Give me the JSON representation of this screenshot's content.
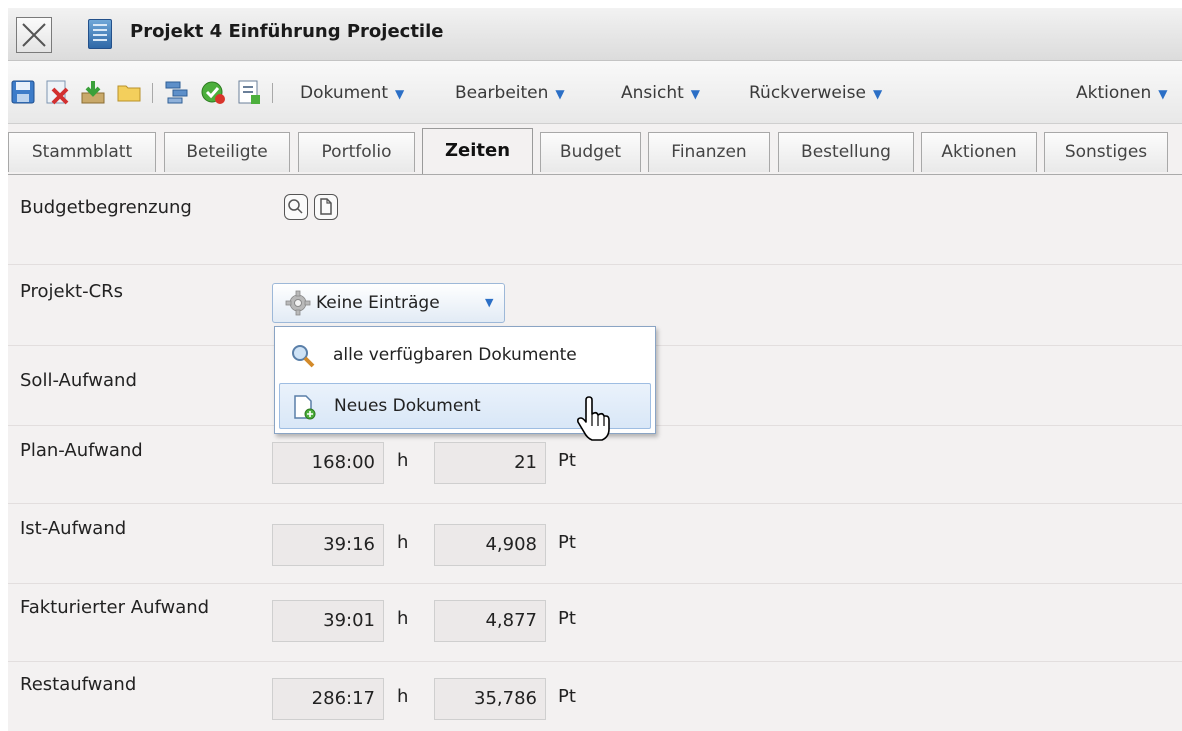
{
  "window": {
    "title": "Projekt 4 Einführung Projectile"
  },
  "toolbar": {
    "icons": [
      "save-icon",
      "delete-icon",
      "import-icon",
      "folder-icon",
      "copy-icon",
      "approve-icon",
      "report-icon"
    ],
    "menus": [
      {
        "label": "Dokument"
      },
      {
        "label": "Bearbeiten"
      },
      {
        "label": "Ansicht"
      },
      {
        "label": "Rückverweise"
      },
      {
        "label": "Aktionen"
      }
    ]
  },
  "tabs": [
    {
      "label": "Stammblatt"
    },
    {
      "label": "Beteiligte"
    },
    {
      "label": "Portfolio"
    },
    {
      "label": "Zeiten",
      "active": true
    },
    {
      "label": "Budget"
    },
    {
      "label": "Finanzen"
    },
    {
      "label": "Bestellung"
    },
    {
      "label": "Aktionen"
    },
    {
      "label": "Sonstiges"
    }
  ],
  "form": {
    "budgetbegrenzung": {
      "label": "Budgetbegrenzung"
    },
    "projekt_crs": {
      "label": "Projekt-CRs",
      "button_label": "Keine Einträge"
    },
    "soll_aufwand": {
      "label": "Soll-Aufwand"
    },
    "plan_aufwand": {
      "label": "Plan-Aufwand",
      "hours": "168:00",
      "hours_unit": "h",
      "points": "21",
      "points_unit": "Pt"
    },
    "ist_aufwand": {
      "label": "Ist-Aufwand",
      "hours": "39:16",
      "hours_unit": "h",
      "points": "4,908",
      "points_unit": "Pt"
    },
    "fakturiert": {
      "label": "Fakturierter Aufwand",
      "hours": "39:01",
      "hours_unit": "h",
      "points": "4,877",
      "points_unit": "Pt"
    },
    "restaufwand": {
      "label": "Restaufwand",
      "hours": "286:17",
      "hours_unit": "h",
      "points": "35,786",
      "points_unit": "Pt"
    }
  },
  "dropdown": {
    "items": [
      {
        "label": "alle verfügbaren Dokumente",
        "icon": "magnifier-icon"
      },
      {
        "label": "Neues Dokument",
        "icon": "new-document-icon",
        "hovered": true
      }
    ]
  },
  "colors": {
    "accent": "#2b6fc6",
    "background": "#f3f1f1",
    "field_bg": "#ece9e9"
  }
}
